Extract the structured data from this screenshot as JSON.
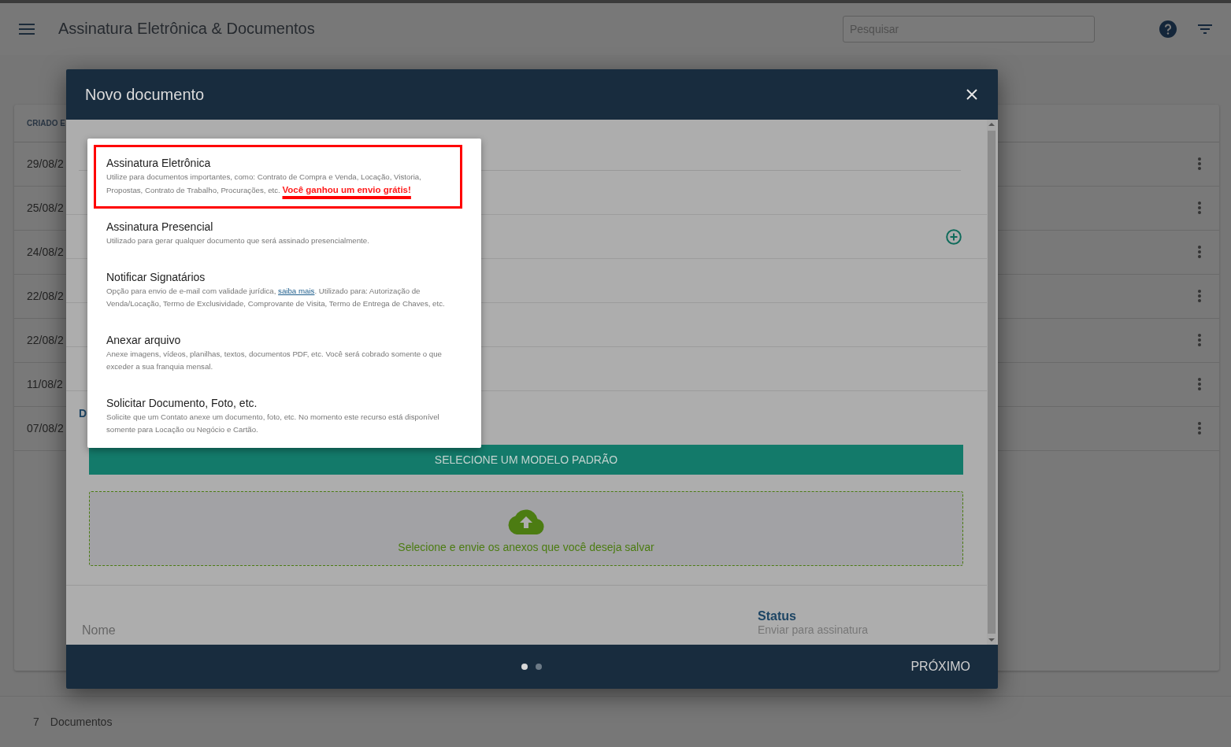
{
  "app_bar": {
    "title": "Assinatura Eletrônica & Documentos",
    "search": {
      "placeholder": "Pesquisar"
    }
  },
  "table": {
    "columns": [
      "CRIADO E"
    ],
    "rows": [
      {
        "created": "29/08/2"
      },
      {
        "created": "25/08/2"
      },
      {
        "created": "24/08/2"
      },
      {
        "created": "22/08/2"
      },
      {
        "created": "22/08/2"
      },
      {
        "created": "11/08/2"
      },
      {
        "created": "07/08/2"
      }
    ]
  },
  "footer": {
    "count": "7",
    "label": "Documentos"
  },
  "dialog": {
    "title": "Novo documento",
    "section_letter": "D",
    "template_button": "SELECIONE UM MODELO PADRÃO",
    "upload_hint": "Selecione e envie os anexos que você deseja salvar",
    "name_label": "Nome",
    "status_label": "Status",
    "status_value": "Enviar para assinatura",
    "pager": [
      {
        "selected": true
      },
      {
        "selected": false
      }
    ],
    "next_button": "PRÓXIMO"
  },
  "menu": {
    "items": [
      {
        "title": "Assinatura Eletrônica",
        "description": "Utilize para documentos importantes, como: Contrato de Compra e Venda, Locação, Vistoria, Propostas, Contrato de Trabalho, Procurações, etc. **Você ganhou um envio grátis!**",
        "selected": true
      },
      {
        "title": "Assinatura Presencial",
        "description": "Utilizado para gerar qualquer documento que será assinado presencialmente.",
        "selected": false
      },
      {
        "title": "Notificar Signatários",
        "description": "Opção para envio de e-mail com validade jurídica, ",
        "link": "saiba mais",
        "description_after": ". Utilizado para: Autorização de Venda/Locação, Termo de Exclusividade, Comprovante de Visita, Termo de Entrega de Chaves, etc.",
        "selected": false
      },
      {
        "title": "Anexar arquivo",
        "description": "Anexe imagens, vídeos, planilhas, textos, documentos PDF, etc. Você será cobrado somente o que exceder a sua franquia mensal.",
        "selected": false
      },
      {
        "title": "Solicitar Documento, Foto, etc.",
        "description": "Solicite que um Contato anexe um documento, foto, etc. No momento este recurso está disponível somente para Locação ou Negócio e Cartão.",
        "selected": false
      }
    ]
  }
}
